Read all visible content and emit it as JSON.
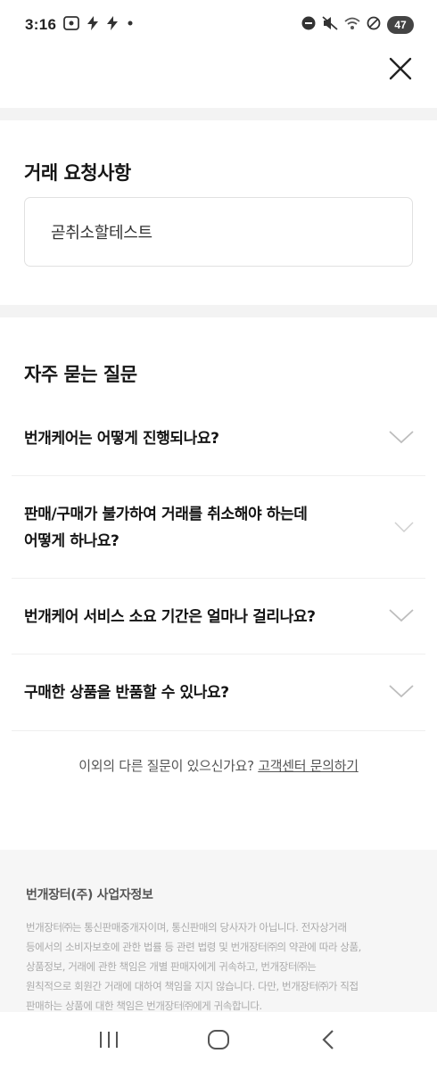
{
  "status_bar": {
    "time": "3:16",
    "battery": "47"
  },
  "request_section": {
    "title": "거래 요청사항",
    "value": "곧취소할테스트"
  },
  "faq": {
    "title": "자주 묻는 질문",
    "items": [
      {
        "question": "번개케어는 어떻게 진행되나요?"
      },
      {
        "question_line1": "판매/구매가 불가하여 거래를 취소해야 하는데",
        "question_line2": "어떻게 하나요?"
      },
      {
        "question": "번개케어 서비스 소요 기간은 얼마나 걸리나요?"
      },
      {
        "question": "구매한 상품을 반품할 수 있나요?"
      }
    ]
  },
  "more": {
    "text": "이외의 다른 질문이 있으신가요?",
    "link": "고객센터 문의하기"
  },
  "footer": {
    "title": "번개장터(주) 사업자정보",
    "lines": [
      "번개장터㈜는 통신판매중개자이며, 통신판매의 당사자가 아닙니다. 전자상거래",
      "등에서의 소비자보호에 관한 법률 등 관련 법령 및 번개장터㈜의 약관에 따라 상품,",
      "상품정보, 거래에 관한 책임은 개별 판매자에게 귀속하고, 번개장터㈜는",
      "원칙적으로 회원간 거래에 대하여 책임을 지지 않습니다. 다만, 번개장터㈜가 직접",
      "판매하는 상품에 대한 책임은 번개장터㈜에게 귀속합니다."
    ]
  },
  "colors": {
    "text": "#141414",
    "divider": "#f3f3f3",
    "footer_bg": "#f6f6f6"
  }
}
